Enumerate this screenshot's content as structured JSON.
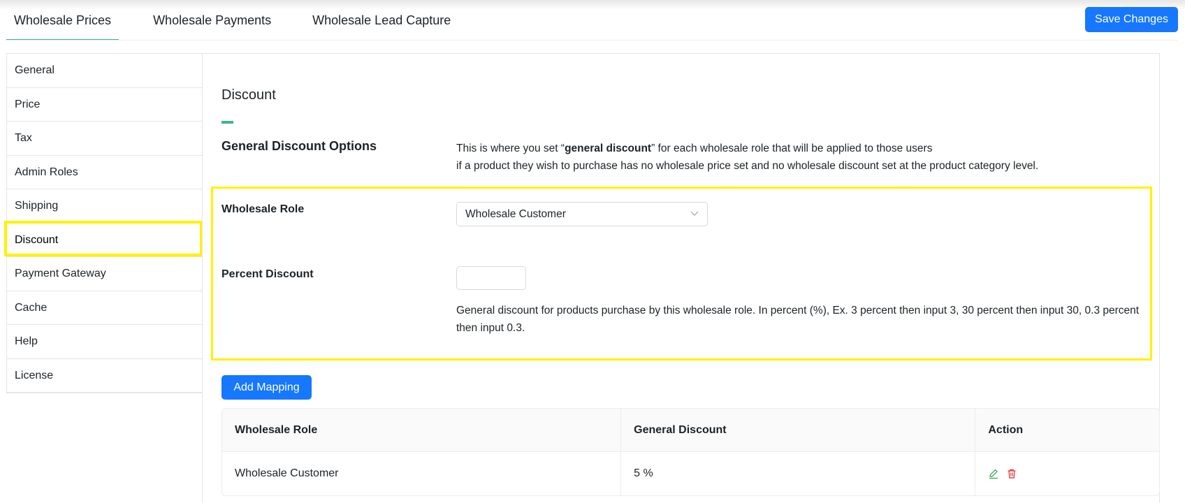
{
  "tabs": [
    {
      "label": "Wholesale Prices",
      "active": true
    },
    {
      "label": "Wholesale Payments",
      "active": false
    },
    {
      "label": "Wholesale Lead Capture",
      "active": false
    }
  ],
  "toolbar": {
    "save_label": "Save Changes"
  },
  "sidebar": {
    "items": [
      {
        "label": "General"
      },
      {
        "label": "Price"
      },
      {
        "label": "Tax"
      },
      {
        "label": "Admin Roles"
      },
      {
        "label": "Shipping"
      },
      {
        "label": "Discount",
        "active": true
      },
      {
        "label": "Payment Gateway"
      },
      {
        "label": "Cache"
      },
      {
        "label": "Help"
      },
      {
        "label": "License"
      }
    ]
  },
  "main": {
    "title": "Discount",
    "general_options": {
      "label": "General Discount Options",
      "desc_pre": "This is where you set “",
      "desc_bold": "general discount",
      "desc_post": "” for each wholesale role that will be applied to those users",
      "desc_line2": "if a product they wish to purchase has no wholesale price set and no wholesale discount set at the product category level."
    },
    "form": {
      "role_label": "Wholesale Role",
      "role_value": "Wholesale Customer",
      "percent_label": "Percent Discount",
      "percent_value": "",
      "percent_help": "General discount for products purchase by this wholesale role. In percent (%), Ex. 3 percent then input 3, 30 percent then input 30, 0.3 percent then input 0.3."
    },
    "add_mapping_label": "Add Mapping",
    "table": {
      "headers": [
        "Wholesale Role",
        "General Discount",
        "Action"
      ],
      "rows": [
        {
          "role": "Wholesale Customer",
          "discount": "5 %"
        }
      ]
    }
  },
  "colors": {
    "accent": "#1677ff",
    "tab_underline": "#3fb58b",
    "highlight": "#fff200",
    "edit_icon": "#2e9e4f",
    "delete_icon": "#e0262b"
  },
  "icons": [
    "chevron-down-icon",
    "edit-icon",
    "delete-icon"
  ]
}
